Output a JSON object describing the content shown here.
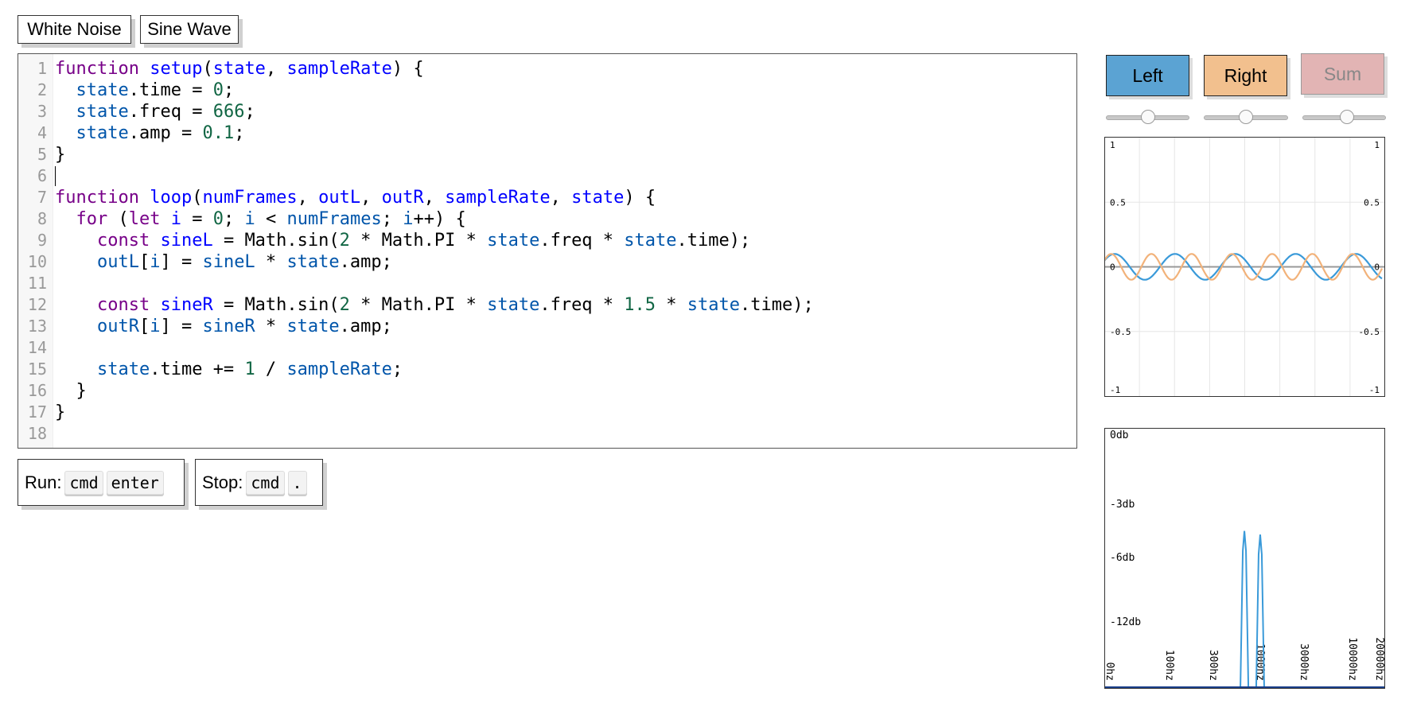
{
  "presets": {
    "white_noise": "White Noise",
    "sine_wave": "Sine Wave"
  },
  "editor": {
    "line_numbers": [
      "1",
      "2",
      "3",
      "4",
      "5",
      "6",
      "7",
      "8",
      "9",
      "10",
      "11",
      "12",
      "13",
      "14",
      "15",
      "16",
      "17",
      "18"
    ],
    "lines": [
      [
        [
          "function",
          "kw"
        ],
        [
          " ",
          "txt"
        ],
        [
          "setup",
          "def"
        ],
        [
          "(",
          "txt"
        ],
        [
          "state",
          "def"
        ],
        [
          ", ",
          "txt"
        ],
        [
          "sampleRate",
          "def"
        ],
        [
          ") {",
          "txt"
        ]
      ],
      [
        [
          "  ",
          "txt"
        ],
        [
          "state",
          "v2"
        ],
        [
          ".time = ",
          "txt"
        ],
        [
          "0",
          "num"
        ],
        [
          ";",
          "txt"
        ]
      ],
      [
        [
          "  ",
          "txt"
        ],
        [
          "state",
          "v2"
        ],
        [
          ".freq = ",
          "txt"
        ],
        [
          "666",
          "num"
        ],
        [
          ";",
          "txt"
        ]
      ],
      [
        [
          "  ",
          "txt"
        ],
        [
          "state",
          "v2"
        ],
        [
          ".amp = ",
          "txt"
        ],
        [
          "0.1",
          "num"
        ],
        [
          ";",
          "txt"
        ]
      ],
      [
        [
          "}",
          "txt"
        ]
      ],
      [],
      [
        [
          "function",
          "kw"
        ],
        [
          " ",
          "txt"
        ],
        [
          "loop",
          "def"
        ],
        [
          "(",
          "txt"
        ],
        [
          "numFrames",
          "def"
        ],
        [
          ", ",
          "txt"
        ],
        [
          "outL",
          "def"
        ],
        [
          ", ",
          "txt"
        ],
        [
          "outR",
          "def"
        ],
        [
          ", ",
          "txt"
        ],
        [
          "sampleRate",
          "def"
        ],
        [
          ", ",
          "txt"
        ],
        [
          "state",
          "def"
        ],
        [
          ") {",
          "txt"
        ]
      ],
      [
        [
          "  ",
          "txt"
        ],
        [
          "for",
          "kw"
        ],
        [
          " (",
          "txt"
        ],
        [
          "let",
          "kw"
        ],
        [
          " ",
          "txt"
        ],
        [
          "i",
          "def"
        ],
        [
          " = ",
          "txt"
        ],
        [
          "0",
          "num"
        ],
        [
          "; ",
          "txt"
        ],
        [
          "i",
          "v2"
        ],
        [
          " < ",
          "txt"
        ],
        [
          "numFrames",
          "v2"
        ],
        [
          "; ",
          "txt"
        ],
        [
          "i",
          "v2"
        ],
        [
          "++) {",
          "txt"
        ]
      ],
      [
        [
          "    ",
          "txt"
        ],
        [
          "const",
          "kw"
        ],
        [
          " ",
          "txt"
        ],
        [
          "sineL",
          "def"
        ],
        [
          " = Math.sin(",
          "txt"
        ],
        [
          "2",
          "num"
        ],
        [
          " * Math.PI * ",
          "txt"
        ],
        [
          "state",
          "v2"
        ],
        [
          ".freq * ",
          "txt"
        ],
        [
          "state",
          "v2"
        ],
        [
          ".time);",
          "txt"
        ]
      ],
      [
        [
          "    ",
          "txt"
        ],
        [
          "outL",
          "v2"
        ],
        [
          "[",
          "txt"
        ],
        [
          "i",
          "v2"
        ],
        [
          "] = ",
          "txt"
        ],
        [
          "sineL",
          "v2"
        ],
        [
          " * ",
          "txt"
        ],
        [
          "state",
          "v2"
        ],
        [
          ".amp;",
          "txt"
        ]
      ],
      [],
      [
        [
          "    ",
          "txt"
        ],
        [
          "const",
          "kw"
        ],
        [
          " ",
          "txt"
        ],
        [
          "sineR",
          "def"
        ],
        [
          " = Math.sin(",
          "txt"
        ],
        [
          "2",
          "num"
        ],
        [
          " * Math.PI * ",
          "txt"
        ],
        [
          "state",
          "v2"
        ],
        [
          ".freq * ",
          "txt"
        ],
        [
          "1.5",
          "num"
        ],
        [
          " * ",
          "txt"
        ],
        [
          "state",
          "v2"
        ],
        [
          ".time);",
          "txt"
        ]
      ],
      [
        [
          "    ",
          "txt"
        ],
        [
          "outR",
          "v2"
        ],
        [
          "[",
          "txt"
        ],
        [
          "i",
          "v2"
        ],
        [
          "] = ",
          "txt"
        ],
        [
          "sineR",
          "v2"
        ],
        [
          " * ",
          "txt"
        ],
        [
          "state",
          "v2"
        ],
        [
          ".amp;",
          "txt"
        ]
      ],
      [],
      [
        [
          "    ",
          "txt"
        ],
        [
          "state",
          "v2"
        ],
        [
          ".time += ",
          "txt"
        ],
        [
          "1",
          "num"
        ],
        [
          " / ",
          "txt"
        ],
        [
          "sampleRate",
          "v2"
        ],
        [
          ";",
          "txt"
        ]
      ],
      [
        [
          "  }",
          "txt"
        ]
      ],
      [
        [
          "}",
          "txt"
        ]
      ],
      []
    ]
  },
  "shortcuts": {
    "run_label": "Run:",
    "run_keys": [
      "cmd",
      "enter"
    ],
    "stop_label": "Stop:",
    "stop_keys": [
      "cmd",
      "."
    ]
  },
  "channels": [
    {
      "label": "Left",
      "color": "#5ba3d3",
      "active": true,
      "slider": 0.5
    },
    {
      "label": "Right",
      "color": "#f2c08e",
      "active": true,
      "slider": 0.5
    },
    {
      "label": "Sum",
      "color": "#e2b4b4",
      "active": false,
      "slider": 0.53
    }
  ],
  "chart_data": [
    {
      "type": "line",
      "ylim": [
        -1,
        1
      ],
      "y_ticks": [
        "1",
        "0.5",
        "0",
        "-0.5",
        "-1"
      ],
      "grid": true,
      "series": [
        {
          "name": "Left",
          "color": "#3a9ad9",
          "amplitude": 0.1,
          "cycles_visible": 4.6
        },
        {
          "name": "Right",
          "color": "#f2b27a",
          "amplitude": 0.1,
          "cycles_visible": 6.9
        }
      ]
    },
    {
      "type": "line",
      "y_ticks": [
        "0db",
        "-3db",
        "-6db",
        "-12db"
      ],
      "x_ticks": [
        "0hz",
        "100hz",
        "300hz",
        "1000hz",
        "3000hz",
        "10000hz",
        "20000hz"
      ],
      "color": "#3a9ad9",
      "peaks": [
        {
          "freq_hz": 666,
          "db": -4.1
        },
        {
          "freq_hz": 999,
          "db": -4.3
        }
      ]
    }
  ]
}
